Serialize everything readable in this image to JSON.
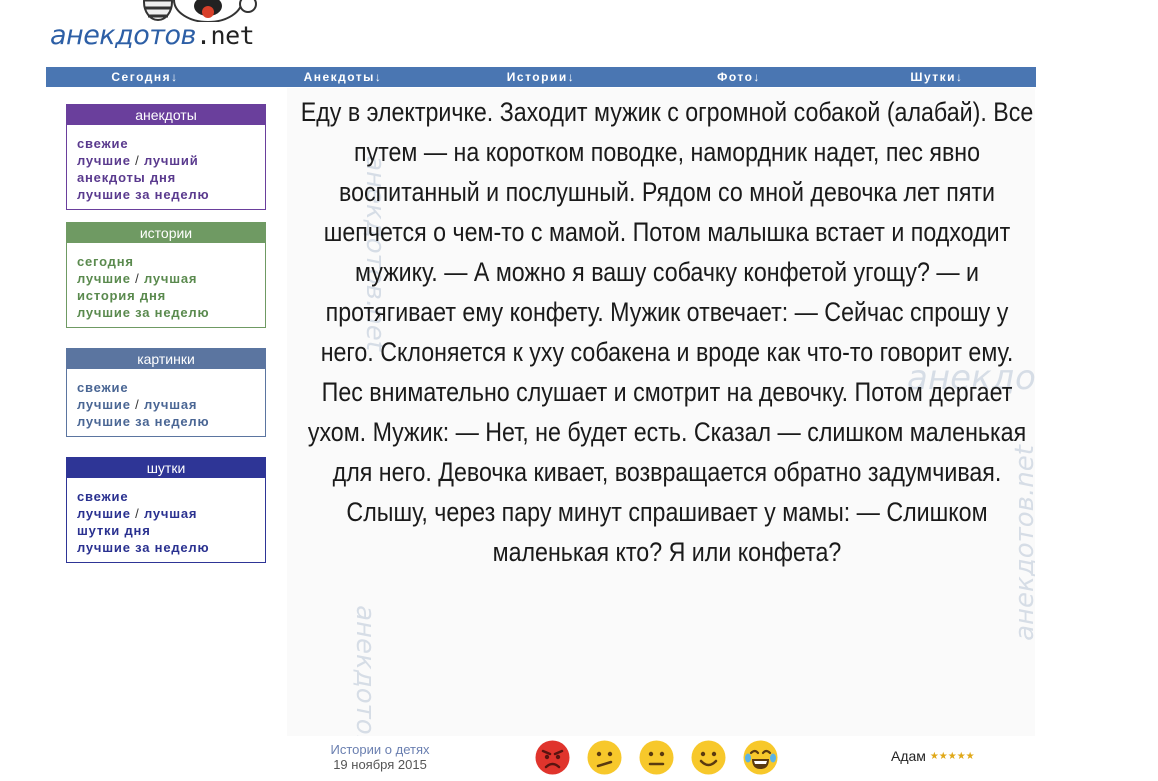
{
  "logo": {
    "text": "анекдотов",
    "tld": ".net"
  },
  "nav": [
    {
      "label": "Сегодня↓"
    },
    {
      "label": "Анекдоты↓"
    },
    {
      "label": "Истории↓"
    },
    {
      "label": "Фото↓"
    },
    {
      "label": "Шутки↓"
    }
  ],
  "sidebar": {
    "anekdoty": {
      "title": "анекдоты",
      "fresh": "свежие",
      "best": "лучшие",
      "sep": "/",
      "best_one": "лучший",
      "of_day": "анекдоты дня",
      "week": "лучшие за неделю"
    },
    "istorii": {
      "title": "истории",
      "today": "сегодня",
      "best": "лучшие",
      "sep": "/",
      "best_one": "лучшая",
      "of_day": "история дня",
      "week": "лучшие за неделю"
    },
    "kartinki": {
      "title": "картинки",
      "fresh": "свежие",
      "best": "лучшие",
      "sep": "/",
      "best_one": "лучшая",
      "week": "лучшие за неделю"
    },
    "shutki": {
      "title": "шутки",
      "fresh": "свежие",
      "best": "лучшие",
      "sep": "/",
      "best_one": "лучшая",
      "of_day": "шутки дня",
      "week": "лучшие за неделю"
    }
  },
  "story": {
    "text": "Еду в электричке. Заходит мужик с огромной собакой (алабай). Все путем — на коротком поводке, намордник надет, пес явно воспитанный и послушный. Рядом со мной девочка лет пяти шепчется о чем-то с мамой. Потом малышка встает и подходит мужику. — А можно я вашу собачку конфетой угощу? — и протягивает ему конфету. Мужик отвечает: — Сейчас спрошу у него. Склоняется к уху собакена и вроде как что-то говорит ему. Пес внимательно слушает и смотрит на девочку. Потом дергает ухом. Мужик: — Нет, не будет есть. Сказал — слишком маленькая для него. Девочка кивает, возвращается обратно задумчивая. Слышу, через пару минут спрашивает у мамы: — Слишком маленькая кто? Я или конфета?",
    "watermark": "анекдотов.net"
  },
  "footer": {
    "category": "Истории о детях",
    "date": "19 ноября 2015",
    "author": "Адам",
    "stars": "★★★★★",
    "rating_level": 5
  },
  "votes": [
    {
      "icon": "angry-face-icon",
      "color": "#e0342c"
    },
    {
      "icon": "confused-face-icon",
      "color": "#f7c82b"
    },
    {
      "icon": "neutral-face-icon",
      "color": "#f7c82b"
    },
    {
      "icon": "smiling-face-icon",
      "color": "#f7c82b"
    },
    {
      "icon": "laughing-tears-face-icon",
      "color": "#f7c82b"
    }
  ]
}
